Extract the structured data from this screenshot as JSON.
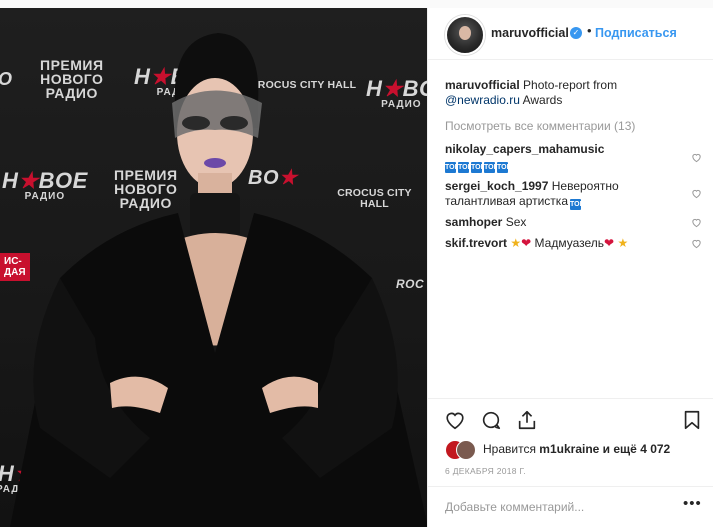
{
  "photo": {
    "wall": {
      "premia": "ПРЕМИЯ\nНОВОГО\nРАДИО",
      "novoe": "H☆ВОЕ",
      "radio": "РАДИО",
      "crocus": "CROCUS CITY HALL"
    }
  },
  "post": {
    "username": "maruvofficial",
    "separator": "•",
    "follow_label": "Подписаться",
    "caption": {
      "user": "maruvofficial",
      "text_before": "Photo-report from",
      "mention": "@newradio.ru",
      "text_after": "Awards"
    },
    "view_all_comments": "Посмотреть все комментарии (13)",
    "comments": [
      {
        "user": "nikolay_capers_mahamusic",
        "text": "",
        "emoji_count": 5
      },
      {
        "user": "sergei_koch_1997",
        "text": "Невероятно талантливая артистка",
        "emoji_count": 1
      },
      {
        "user": "samhoper",
        "text": "Sex",
        "emoji_count": 0
      },
      {
        "user": "skif.trevort",
        "text": "Мадмуазель",
        "emoji_count": 0
      }
    ],
    "emoji_glyph": "TOP",
    "likes_prefix": "Нравится",
    "likes_user": "m1ukraine",
    "likes_suffix": "и ещё 4 072",
    "date": "6 ДЕКАБРЯ 2018 Г.",
    "comment_placeholder": "Добавьте комментарий...",
    "more_label": "•••"
  },
  "colors": {
    "accent": "#3897f0",
    "link": "#003569",
    "muted": "#999999",
    "brand_red": "#c8102e"
  },
  "icons": [
    "verified-icon",
    "heart-icon",
    "comment-icon",
    "share-icon",
    "bookmark-icon",
    "like-small-icon"
  ]
}
